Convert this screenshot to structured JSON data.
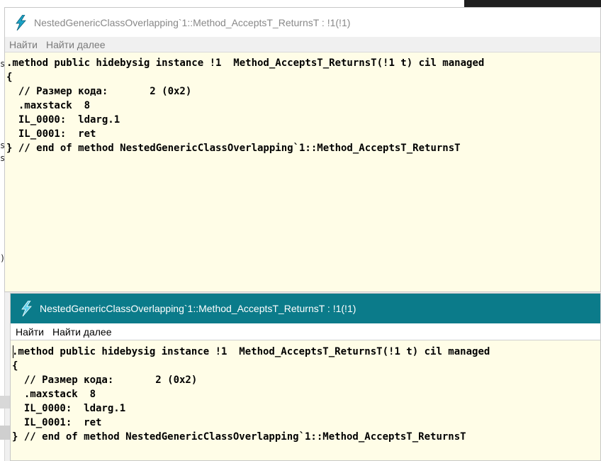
{
  "background": {
    "edge_chars": [
      "s",
      "s",
      "s",
      ")"
    ]
  },
  "window1": {
    "title": "NestedGenericClassOverlapping`1::Method_AcceptsT_ReturnsT : !1(!1)",
    "menu": [
      "Найти",
      "Найти далее"
    ],
    "code_lines": [
      ".method public hidebysig instance !1  Method_AcceptsT_ReturnsT(!1 t) cil managed",
      "{",
      "  // Размер кода:       2 (0x2)",
      "  .maxstack  8",
      "  IL_0000:  ldarg.1",
      "  IL_0001:  ret",
      "} // end of method NestedGenericClassOverlapping`1::Method_AcceptsT_ReturnsT"
    ]
  },
  "window2": {
    "title": "NestedGenericClassOverlapping`1::Method_AcceptsT_ReturnsT : !1(!1)",
    "menu": [
      "Найти",
      "Найти далее"
    ],
    "code_lines": [
      ".method public hidebysig instance !1  Method_AcceptsT_ReturnsT(!1 t) cil managed",
      "{",
      "  // Размер кода:       2 (0x2)",
      "  .maxstack  8",
      "  IL_0000:  ldarg.1",
      "  IL_0001:  ret",
      "} // end of method NestedGenericClassOverlapping`1::Method_AcceptsT_ReturnsT"
    ]
  },
  "colors": {
    "code_background": "#fffde7",
    "active_titlebar": "#0b7b8a",
    "icon_accent": "#1ba3c7"
  },
  "icons": {
    "app": "lightning-bolt-icon"
  }
}
